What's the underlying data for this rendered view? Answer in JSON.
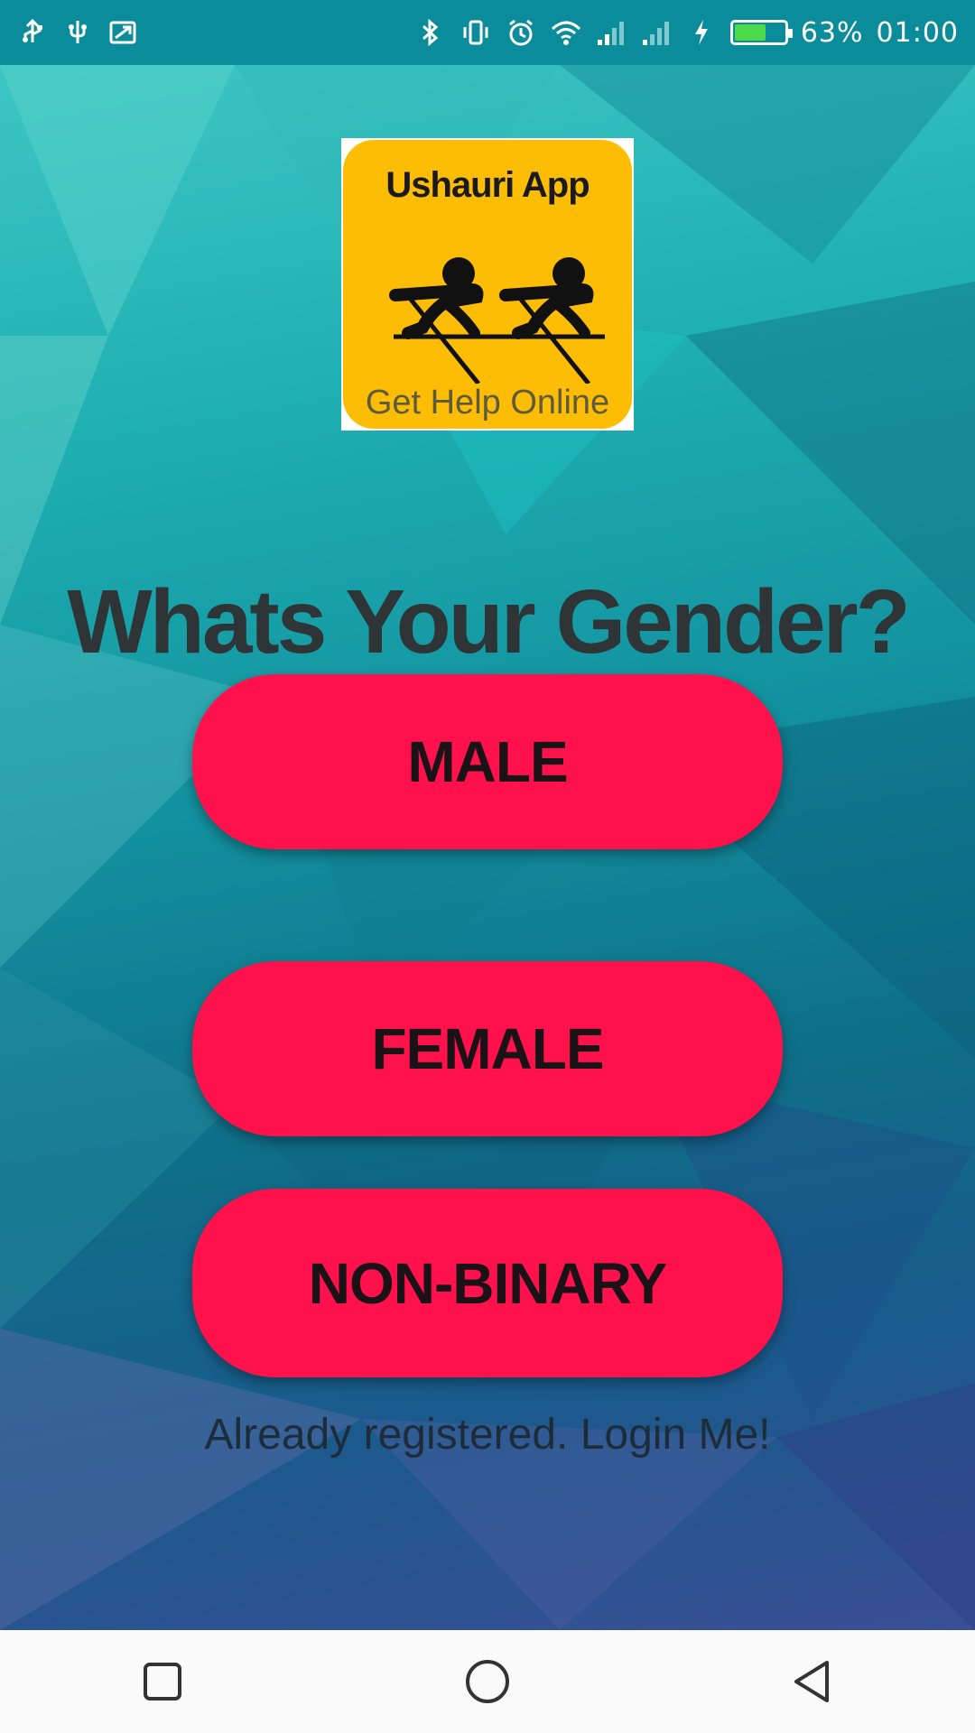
{
  "status_bar": {
    "left_icons": [
      "usb-icon",
      "usb-debug-icon",
      "screencast-icon"
    ],
    "right_icons": [
      "bluetooth-icon",
      "vibrate-icon",
      "alarm-icon",
      "wifi-icon",
      "signal-icon",
      "signal-icon-2",
      "charging-icon"
    ],
    "battery_percent": "63%",
    "battery_level": 0.63,
    "time": "01:00"
  },
  "logo": {
    "title": "Ushauri App",
    "subtitle": "Get Help Online",
    "icon": "rowers-icon"
  },
  "page": {
    "question": "Whats Your Gender?"
  },
  "buttons": {
    "male": "MALE",
    "female": "FEMALE",
    "non_binary": "NON-BINARY"
  },
  "login_link": "Already registered. Login Me!",
  "nav": {
    "recents": "square-icon",
    "home": "circle-icon",
    "back": "triangle-back-icon"
  },
  "colors": {
    "button": "#ff114c",
    "logo_bg": "#fdbd05",
    "status_bar": "#0a8c9a"
  }
}
